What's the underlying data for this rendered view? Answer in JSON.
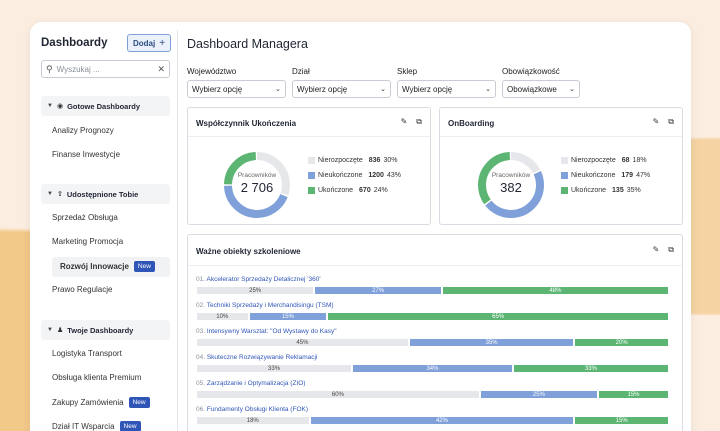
{
  "sidebar": {
    "title": "Dashboardy",
    "add_label": "Dodaj",
    "search_placeholder": "Wyszukaj ...",
    "groups": [
      {
        "label": "Gotowe Dashboardy",
        "items": [
          {
            "label": "Analizy Prognozy"
          },
          {
            "label": "Finanse Inwestycje"
          }
        ]
      },
      {
        "label": "Udostępnione Tobie",
        "items": [
          {
            "label": "Sprzedaż Obsługa"
          },
          {
            "label": "Marketing Promocja"
          },
          {
            "label": "Rozwój Innowacje",
            "badge": "New"
          },
          {
            "label": "Prawo Regulacje"
          }
        ]
      },
      {
        "label": "Twoje Dashboardy",
        "items": [
          {
            "label": "Logistyka Transport"
          },
          {
            "label": "Obsługa klienta Premium"
          },
          {
            "label": "Zakupy Zamówienia",
            "badge": "New"
          },
          {
            "label": "Dział IT Wsparcia",
            "badge": "New"
          }
        ]
      }
    ]
  },
  "main": {
    "title": "Dashboard Managera",
    "filters": [
      {
        "label": "Województwo",
        "value": "Wybierz opcję"
      },
      {
        "label": "Dział",
        "value": "Wybierz opcję"
      },
      {
        "label": "Sklep",
        "value": "Wybierz opcję"
      },
      {
        "label": "Obowiązkowość",
        "value": "Obowiązkowe"
      }
    ],
    "cards": [
      {
        "title": "Współczynnik Ukończenia",
        "caption": "Pracowników",
        "total": "2 706",
        "legend": [
          {
            "label": "Nierozpoczęte",
            "count": "836",
            "pct": "30%",
            "value": 30
          },
          {
            "label": "Nieukończone",
            "count": "1200",
            "pct": "43%",
            "value": 43
          },
          {
            "label": "Ukończone",
            "count": "670",
            "pct": "24%",
            "value": 24
          }
        ]
      },
      {
        "title": "OnBoarding",
        "caption": "Pracowników",
        "total": "382",
        "legend": [
          {
            "label": "Nierozpoczęte",
            "count": "68",
            "pct": "18%",
            "value": 18
          },
          {
            "label": "Nieukończone",
            "count": "179",
            "pct": "47%",
            "value": 47
          },
          {
            "label": "Ukończone",
            "count": "135",
            "pct": "35%",
            "value": 35
          }
        ]
      }
    ],
    "objects": {
      "title": "Ważne obiekty szkoleniowe",
      "items": [
        {
          "idx": "01.",
          "name": "Akcelerator Sprzedaży Detalicznej '360'",
          "g": 25,
          "b": 27,
          "gr": 48,
          "g_label": "25%",
          "b_label": "27%",
          "gr_label": "48%"
        },
        {
          "idx": "02.",
          "name": "Techniki Sprzedaży i Merchandisingu (TSM)",
          "g": 10,
          "b": 15,
          "gr": 65,
          "g_label": "10%",
          "b_label": "15%",
          "gr_label": "65%"
        },
        {
          "idx": "03.",
          "name": "Intensywny Warsztat: \"Od Wystawy do Kasy\"",
          "g": 45,
          "b": 35,
          "gr": 20,
          "g_label": "45%",
          "b_label": "35%",
          "gr_label": "20%"
        },
        {
          "idx": "04.",
          "name": "Skuteczne Rozwiązywanie Reklamacji",
          "g": 33,
          "b": 34,
          "gr": 33,
          "g_label": "33%",
          "b_label": "34%",
          "gr_label": "33%"
        },
        {
          "idx": "05.",
          "name": "Zarządzanie i Optymalizacja (ZIO)",
          "g": 60,
          "b": 25,
          "gr": 15,
          "g_label": "60%",
          "b_label": "25%",
          "gr_label": "15%"
        },
        {
          "idx": "06.",
          "name": "Fundamenty Obsługi Klienta (FOK)",
          "g": 18,
          "b": 42,
          "gr": 15,
          "g_label": "18%",
          "b_label": "42%",
          "gr_label": "15%"
        }
      ]
    }
  },
  "colors": {
    "nierozpoczete": "#e6e7ea",
    "nieukonczone": "#7fa0d9",
    "ukonczone": "#5db574",
    "accent": "#2f56b7"
  },
  "icons": {
    "edit": "pencil-icon",
    "copy": "copy-icon"
  }
}
